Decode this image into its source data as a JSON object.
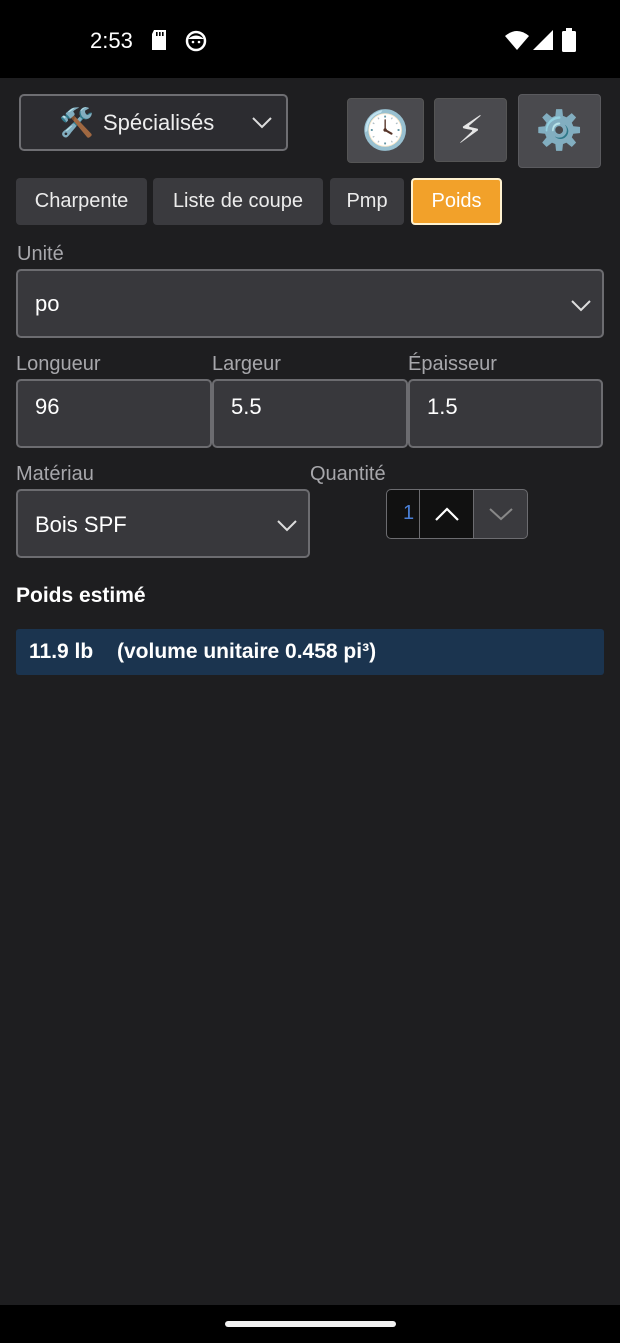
{
  "status_bar": {
    "time": "2:53",
    "icons": [
      "sd-card-icon",
      "face-icon",
      "wifi-icon",
      "signal-icon",
      "battery-icon"
    ]
  },
  "toolbar": {
    "mode_emoji": "🛠️",
    "mode_label": "Spécialisés",
    "history_emoji": "🕓",
    "flash_emoji": "⚡",
    "settings_emoji": "⚙️"
  },
  "tabs": [
    {
      "label": "Charpente",
      "active": false
    },
    {
      "label": "Liste de coupe",
      "active": false
    },
    {
      "label": "Pmp",
      "active": false
    },
    {
      "label": "Poids",
      "active": true
    }
  ],
  "form": {
    "unit_label": "Unité",
    "unit_value": "po",
    "length_label": "Longueur",
    "length_value": "96",
    "width_label": "Largeur",
    "width_value": "5.5",
    "thickness_label": "Épaisseur",
    "thickness_value": "1.5",
    "material_label": "Matériau",
    "material_value": "Bois SPF",
    "quantity_label": "Quantité",
    "quantity_value": "1"
  },
  "result": {
    "heading": "Poids estimé",
    "weight": "11.9 lb",
    "volume": "(volume unitaire 0.458 pi³)"
  },
  "colors": {
    "background": "#1e1e20",
    "active_tab": "#f2a12a",
    "result_bar": "#1b344f"
  }
}
